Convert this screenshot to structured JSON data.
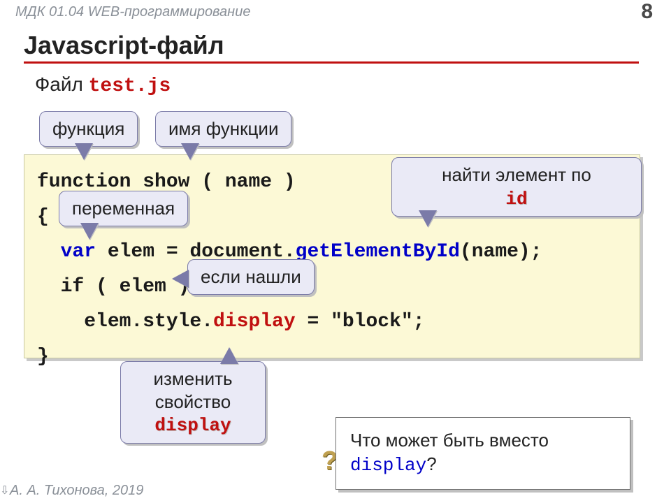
{
  "header": {
    "breadcrumb": "МДК 01.04 WEB-программирование",
    "page_number": "8"
  },
  "title": "Javascript-файл",
  "subtitle": {
    "prefix": "Файл ",
    "filename": "test.js"
  },
  "code": {
    "l1a": "function",
    "l1b": " show ( name )",
    "l2": "{",
    "l3a": "  var",
    "l3b": " elem = document.",
    "l3c": "getElementById",
    "l3d": "(name);",
    "l4": "  if ( elem )",
    "l5a": "    elem.style.",
    "l5b": "display",
    "l5c": " = \"block\";",
    "l6": "}"
  },
  "callouts": {
    "function_kw": "функция",
    "function_name": "имя функции",
    "variable": "переменная",
    "find_by_id_text": "найти элемент по",
    "find_by_id_kw": "id",
    "if_found": "если нашли",
    "change_prop_text": "изменить\nсвойство",
    "change_prop_kw": "display"
  },
  "question": {
    "text_pre": "Что может быть вместо ",
    "kw": "display",
    "text_post": "?"
  },
  "footer": {
    "author": "А. А. Тихонова, 2019"
  }
}
